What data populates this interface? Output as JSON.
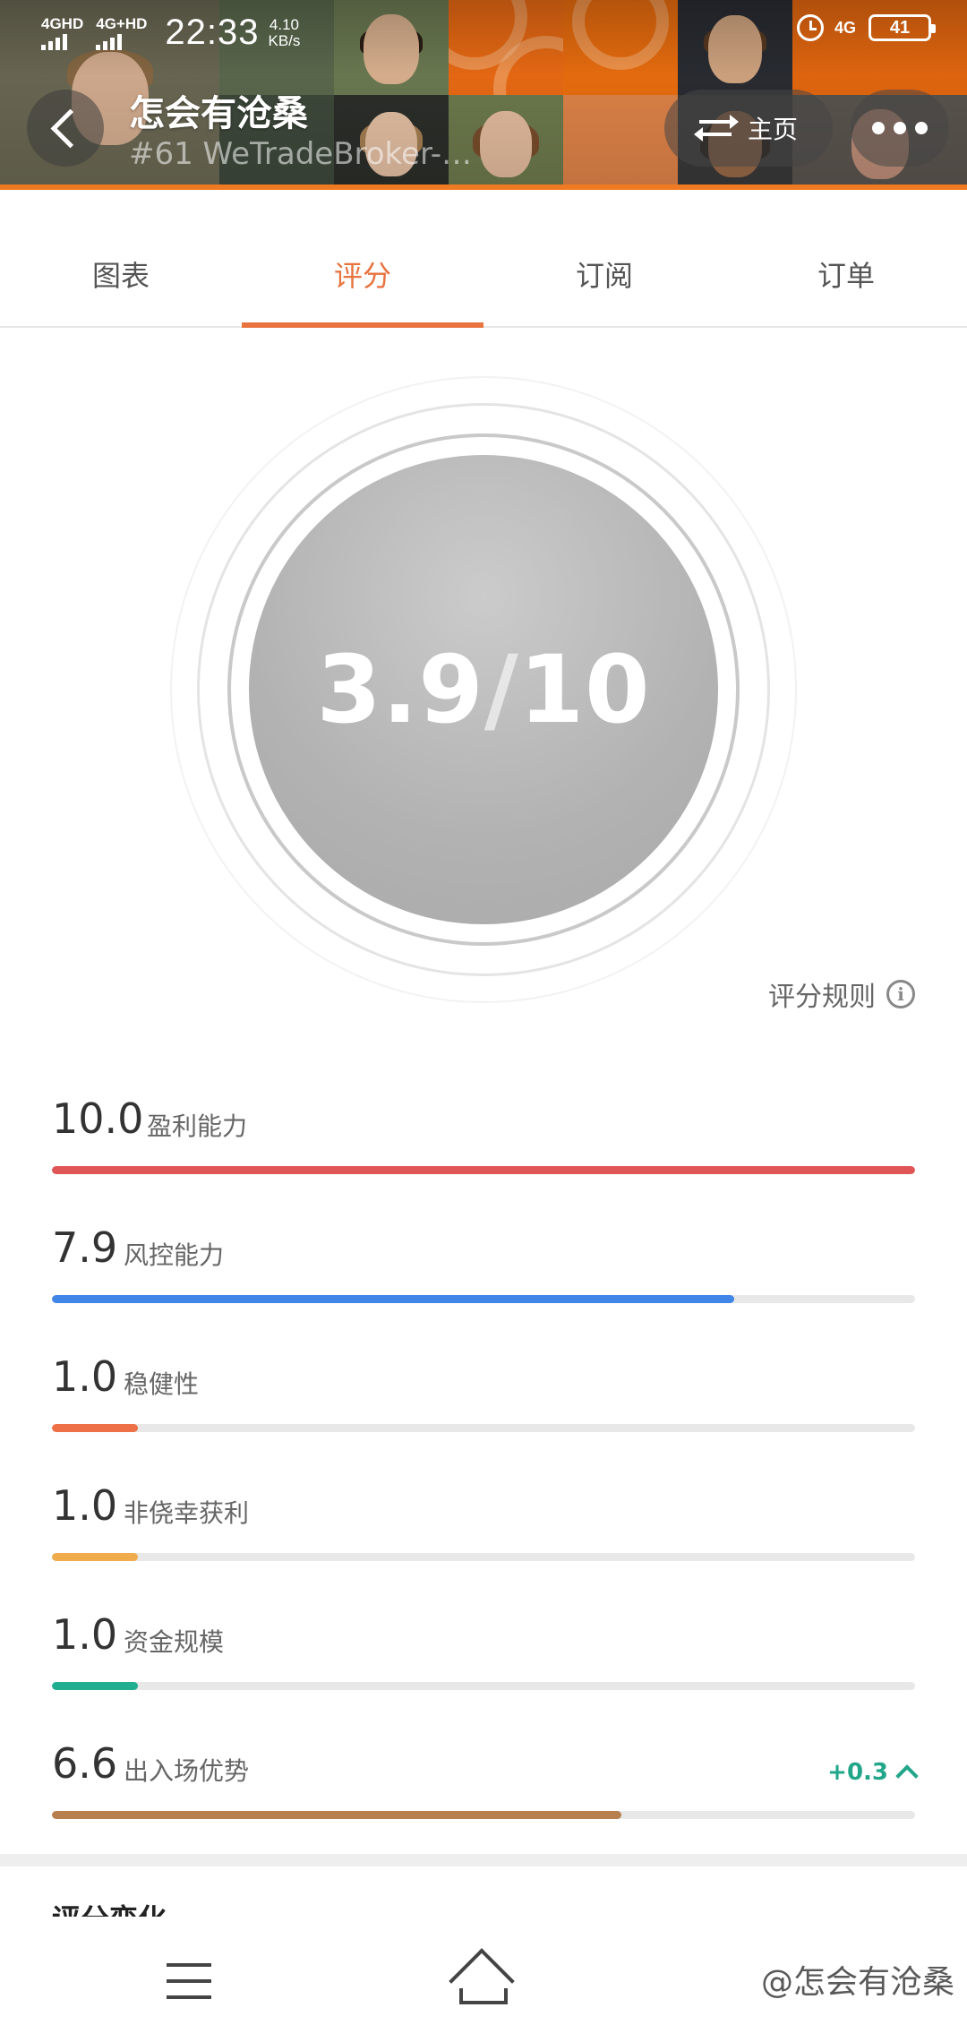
{
  "status_bar": {
    "signal1": "4GHD",
    "signal2": "4G+HD",
    "time": "22:33",
    "speed_value": "4.10",
    "speed_unit": "KB/s",
    "network": "4G",
    "battery": "41"
  },
  "header": {
    "title": "怎会有沧桑",
    "subtitle": "#61 WeTradeBroker-…",
    "home_label": "主页"
  },
  "tabs": [
    "图表",
    "评分",
    "订阅",
    "订单"
  ],
  "active_tab": "评分",
  "score": {
    "value": "3.9",
    "slash": "/",
    "max": "10",
    "rules_label": "评分规则",
    "info_glyph": "i"
  },
  "metrics": [
    {
      "value": "10.0",
      "label": "盈利能力",
      "fraction": 1.0,
      "color": "#e05555"
    },
    {
      "value": "7.9",
      "label": "风控能力",
      "fraction": 0.79,
      "color": "#3f86e6"
    },
    {
      "value": "1.0",
      "label": "稳健性",
      "fraction": 0.1,
      "color": "#ee7046"
    },
    {
      "value": "1.0",
      "label": "非侥幸获利",
      "fraction": 0.1,
      "color": "#f0ac4c"
    },
    {
      "value": "1.0",
      "label": "资金规模",
      "fraction": 0.1,
      "color": "#1fae90"
    },
    {
      "value": "6.6",
      "label": "出入场优势",
      "fraction": 0.66,
      "color": "#b8804f",
      "change": "+0.3"
    }
  ],
  "section_title": "评分变化",
  "watermark": "@怎会有沧桑"
}
